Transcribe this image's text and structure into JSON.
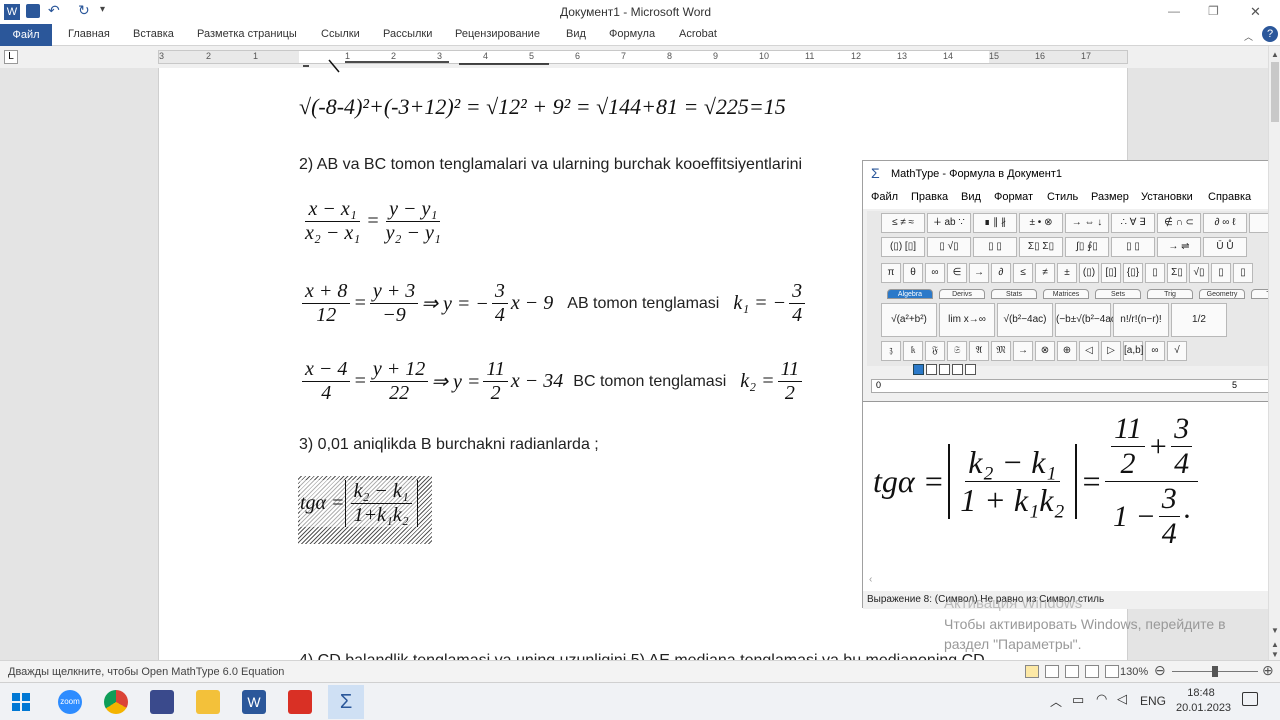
{
  "window": {
    "title": "Документ1 - Microsoft Word",
    "controls": {
      "minimize": "—",
      "maximize": "❐",
      "close": "✕"
    }
  },
  "qat": {
    "icons": [
      "W",
      "💾",
      "↶",
      "↻",
      "▾"
    ]
  },
  "ribbon": {
    "tabs": [
      "Файл",
      "Главная",
      "Вставка",
      "Разметка страницы",
      "Ссылки",
      "Рассылки",
      "Рецензирование",
      "Вид",
      "Формула",
      "Acrobat"
    ],
    "help": "?"
  },
  "ruler": {
    "numbers": [
      "3",
      "2",
      "1",
      "1",
      "2",
      "3",
      "4",
      "5",
      "6",
      "7",
      "8",
      "9",
      "10",
      "11",
      "12",
      "13",
      "14",
      "15",
      "16",
      "17"
    ],
    "corner": "L"
  },
  "document": {
    "step1_eq": {
      "a": "-8-4",
      "b": "-3+12",
      "r1": "12",
      "r2": "9",
      "s": "144+81",
      "t": "225",
      "res": "=15"
    },
    "step2_heading": "2) AB va BC tomon tenglamalari va ularning burchak kooeffitsiyentlarini",
    "eq_ab_text": "AB tomon tenglamasi",
    "eq_bc_text": "BC tomon tenglamasi",
    "step3_heading": "3) 0,01 aniqlikda B burchakni radianlarda ;",
    "step4_heading": "4) CD balandlik tenglamasi va uning uzunligini 5) AE mediana tenglamasi va bu medianoning CD"
  },
  "mathtype": {
    "title": "MathType - Формула в Документ1",
    "menu": [
      "Файл",
      "Правка",
      "Вид",
      "Формат",
      "Стиль",
      "Размер",
      "Установки",
      "Справка"
    ],
    "row1": [
      "≤ ≠ ≈",
      "∔ ab ∵",
      "∎ ∥ ∦",
      "± • ⊗",
      "→ ⇔ ↓",
      "∴ ∀ ∃",
      "∉ ∩ ⊂",
      "∂ ∞ ℓ",
      "λ"
    ],
    "row2": [
      "(▯) [▯]",
      "▯ √▯",
      "▯ ▯",
      "Σ▯ Σ▯",
      "∫▯ ∮▯",
      "▯ ▯",
      "→ ⇌",
      "Ū Ů"
    ],
    "row3": [
      "π",
      "θ",
      "∞",
      "∈",
      "→",
      "∂",
      "≤",
      "≠",
      "±",
      "(▯)",
      "[▯]",
      "{▯}",
      "▯",
      "Σ▯",
      "√▯",
      "▯",
      "▯"
    ],
    "tabs": [
      "Algebra",
      "Derivs",
      "Stats",
      "Matrices",
      "Sets",
      "Trig",
      "Geometry",
      "Tab8"
    ],
    "row4": [
      "√(a²+b²)",
      "lim x→∞",
      "√(b²−4ac)",
      "(−b±√(b²−4ac))/2a",
      "n!/r!(n−r)!",
      "1/2"
    ],
    "row5": [
      "𝔷",
      "𝔨",
      "𝔉",
      "𝔖",
      "𝔄",
      "𝔐",
      "→",
      "⊗",
      "⊕",
      "◁",
      "▷",
      "[a,b]",
      "∞",
      "√"
    ],
    "ruler_nums": [
      "0",
      "5"
    ],
    "status": "Выражение 8: (Символ) Не равно из Символ стиль"
  },
  "activation": {
    "title": "Активация Windows",
    "line1": "Чтобы активировать Windows, перейдите в",
    "line2": "раздел \"Параметры\"."
  },
  "statusbar": {
    "hint": "Дважды щелкните, чтобы Open MathType 6.0 Equation",
    "zoom": "130%"
  },
  "taskbar": {
    "apps": [
      "zoom",
      "chrome",
      "files",
      "word",
      "pdf",
      "mathtype"
    ],
    "lang": "ENG",
    "time": "18:48",
    "date": "20.01.2023"
  }
}
